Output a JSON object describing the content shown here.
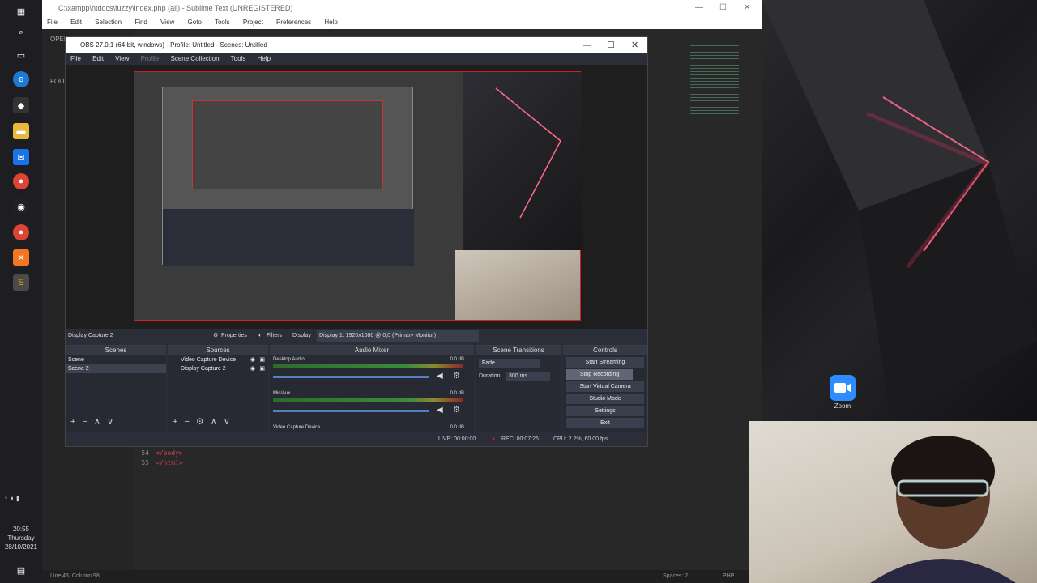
{
  "taskbar": {
    "time": "20:55",
    "day": "Thursday",
    "date": "28/10/2021"
  },
  "sublime": {
    "title": "C:\\xampp\\htdocs\\fuzzy\\index.php (all) - Sublime Text (UNREGISTERED)",
    "menu": [
      "File",
      "Edit",
      "Selection",
      "Find",
      "View",
      "Goto",
      "Tools",
      "Project",
      "Preferences",
      "Help"
    ],
    "sidebar_open_files": "OPEN FILES",
    "sidebar_folders": "FOLDERS",
    "code": [
      {
        "ln": "54",
        "text": "</body>"
      },
      {
        "ln": "55",
        "text": "</html>"
      }
    ],
    "status_left": "Line 45, Column 98",
    "status_spaces": "Spaces: 2",
    "status_syntax": "PHP"
  },
  "obs": {
    "title": "OBS 27.0.1 (64-bit, windows) - Profile: Untitled - Scenes: Untitled",
    "menu": [
      "File",
      "Edit",
      "View",
      "Profile",
      "Scene Collection",
      "Tools",
      "Help"
    ],
    "source_name": "Display Capture 2",
    "properties_label": "Properties",
    "filters_label": "Filters",
    "display_label": "Display",
    "display_value": "Display 1: 1920x1080 @ 0,0 (Primary Monitor)",
    "scenes": {
      "header": "Scenes",
      "items": [
        "Scene",
        "Scene 2"
      ]
    },
    "sources": {
      "header": "Sources",
      "items": [
        "Video Capture Device",
        "Display Capture 2"
      ]
    },
    "mixer": {
      "header": "Audio Mixer",
      "channels": [
        {
          "name": "Desktop Audio",
          "db": "0.0 dB"
        },
        {
          "name": "Mic/Aux",
          "db": "0.0 dB"
        },
        {
          "name": "Video Capture Device",
          "db": "0.0 dB"
        }
      ]
    },
    "transitions": {
      "header": "Scene Transitions",
      "type": "Fade",
      "duration_label": "Duration",
      "duration_value": "300 ms"
    },
    "controls": {
      "header": "Controls",
      "buttons": [
        "Start Streaming",
        "Stop Recording",
        "Start Virtual Camera",
        "Studio Mode",
        "Settings",
        "Exit"
      ]
    },
    "status": {
      "live": "LIVE: 00:00:00",
      "rec": "REC: 00:07:26",
      "cpu": "CPU: 2.2%, 60.00 fps"
    }
  },
  "desktop": {
    "zoom_label": "Zoom"
  },
  "colors": {
    "obs_bg": "#2b2e38",
    "selection_red": "#d02020",
    "zoom_blue": "#2d8cff"
  }
}
